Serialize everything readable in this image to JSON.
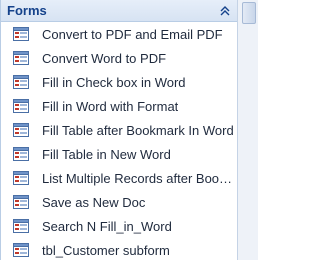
{
  "nav_pane": {
    "group": {
      "title": "Forms",
      "collapse_icon": "double-chevron-up-icon"
    },
    "items": [
      {
        "label": "Convert to PDF and Email PDF",
        "icon": "form-icon"
      },
      {
        "label": "Convert Word to PDF",
        "icon": "form-icon"
      },
      {
        "label": "Fill in Check box in Word",
        "icon": "form-icon"
      },
      {
        "label": "Fill in Word with Format",
        "icon": "form-icon"
      },
      {
        "label": "Fill Table after Bookmark In Word",
        "icon": "form-icon"
      },
      {
        "label": "Fill Table in New Word",
        "icon": "form-icon"
      },
      {
        "label": "List Multiple Records after Bookm...",
        "icon": "form-icon"
      },
      {
        "label": "Save as New Doc",
        "icon": "form-icon"
      },
      {
        "label": "Search N Fill_in_Word",
        "icon": "form-icon"
      },
      {
        "label": "tbl_Customer subform",
        "icon": "form-icon"
      }
    ]
  },
  "colors": {
    "header_text": "#15428b",
    "header_bg": "#dbe6f5",
    "icon_accent": "#c0392b",
    "icon_frame": "#4a6fa5"
  }
}
